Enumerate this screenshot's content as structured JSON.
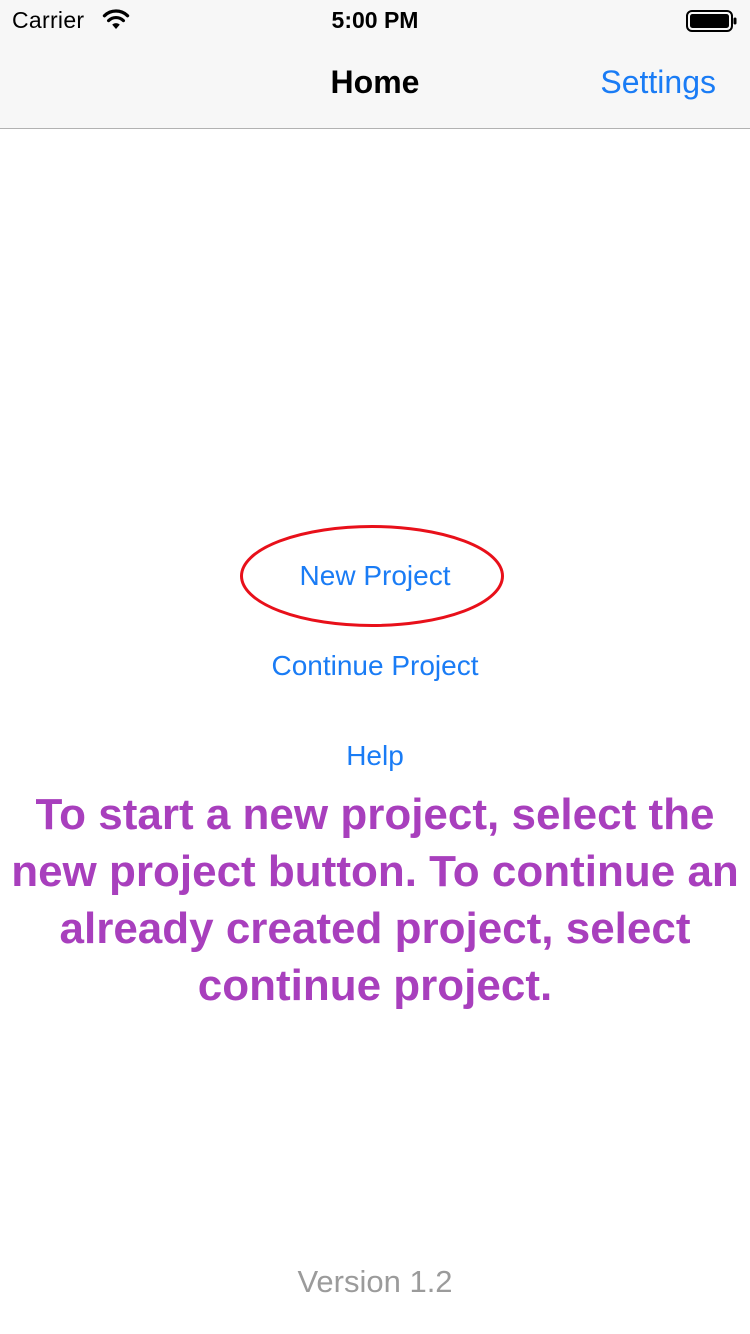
{
  "status_bar": {
    "carrier": "Carrier",
    "time": "5:00 PM",
    "wifi_icon": "wifi-icon",
    "battery_icon": "battery-icon"
  },
  "nav": {
    "title": "Home",
    "settings_label": "Settings"
  },
  "main": {
    "new_project_label": "New Project",
    "continue_project_label": "Continue Project",
    "help_label": "Help"
  },
  "annotation": {
    "text": "To start a new project, select the new project button. To continue an already created project, select continue project."
  },
  "footer": {
    "version": "Version 1.2"
  },
  "colors": {
    "accent": "#1a7cf5",
    "annotation": "#a83fbd",
    "highlight": "#e8101a",
    "muted": "#9b9b9b"
  }
}
